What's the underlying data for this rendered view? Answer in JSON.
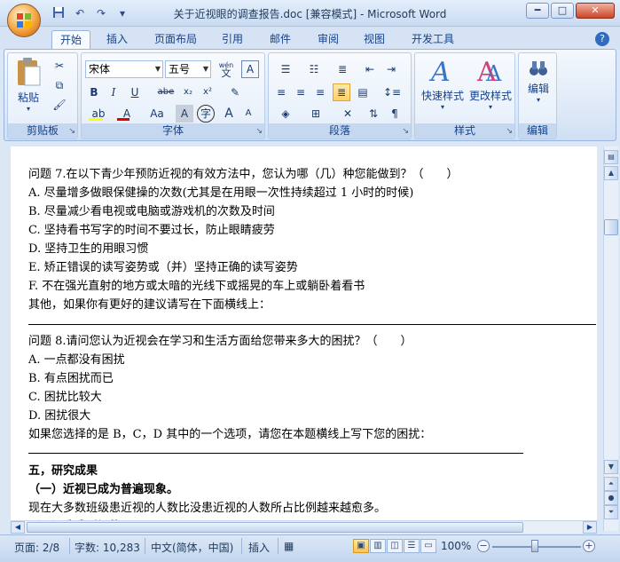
{
  "window": {
    "title": "关于近视眼的调查报告.doc [兼容模式] - Microsoft Word",
    "buttons": {
      "minimize": "━",
      "maximize": "□",
      "close": "✕"
    }
  },
  "tabs": [
    {
      "label": "开始",
      "active": true
    },
    {
      "label": "插入"
    },
    {
      "label": "页面布局"
    },
    {
      "label": "引用"
    },
    {
      "label": "邮件"
    },
    {
      "label": "审阅"
    },
    {
      "label": "视图"
    },
    {
      "label": "开发工具"
    }
  ],
  "ribbon": {
    "clipboard": {
      "label": "剪贴板",
      "paste": "粘贴"
    },
    "font": {
      "label": "字体",
      "font_name": "宋体",
      "font_size": "五号",
      "bold": "B",
      "italic": "I",
      "underline": "U",
      "strike": "abe",
      "subscript": "x₂",
      "superscript": "x²",
      "grow": "A",
      "shrink": "A",
      "font_color": "A",
      "char_case": "Aa",
      "shade": "A",
      "enclose": "字",
      "wen": "wén",
      "wen_char": "文",
      "border_a": "A"
    },
    "paragraph": {
      "label": "段落"
    },
    "styles": {
      "label": "样式",
      "quick_styles": "快速样式",
      "change_styles": "更改样式"
    },
    "editing": {
      "label": "编辑",
      "edit": "编辑"
    }
  },
  "document": {
    "lines": [
      "问题 7.在以下青少年预防近视的有效方法中，您认为哪（几）种您能做到？（　　）",
      "A. 尽量增多做眼保健操的次数(尤其是在用眼一次性持续超过 1 小时的时候)",
      "B. 尽量减少看电视或电脑或游戏机的次数及时间",
      "C. 坚持看书写字的时间不要过长，防止眼睛疲劳",
      "D. 坚持卫生的用眼习惯",
      "E. 矫正错误的读写姿势或（并）坚持正确的读写姿势",
      "F. 不在强光直射的地方或太暗的光线下或摇晃的车上或躺卧着看书",
      " 其他，如果你有更好的建议请写在下面横线上：",
      "问题 8.请问您认为近视会在学习和生活方面给您带来多大的困扰？（　　）",
      "A. 一点都没有困扰",
      "B. 有点困扰而已",
      "C. 困扰比较大",
      "D. 困扰很大",
      "如果您选择的是 B，C，D 其中的一个选项，请您在本题横线上写下您的困扰：",
      "五，研究成果",
      "（一）近视已成为普遍现象。",
      "现在大多数班级患近视的人数比没患近视的人数所占比例越来越愈多。",
      "（二）造成近视的原因"
    ]
  },
  "statusbar": {
    "page": "页面: 2/8",
    "words": "字数: 10,283",
    "language": "中文(简体，中国)",
    "mode": "插入",
    "zoom": "100%",
    "zoom_minus": "−",
    "zoom_plus": "+"
  },
  "colors": {
    "accent": "#15428b",
    "font_color_bar": "#e00000",
    "highlight_bar": "#ffff00"
  }
}
